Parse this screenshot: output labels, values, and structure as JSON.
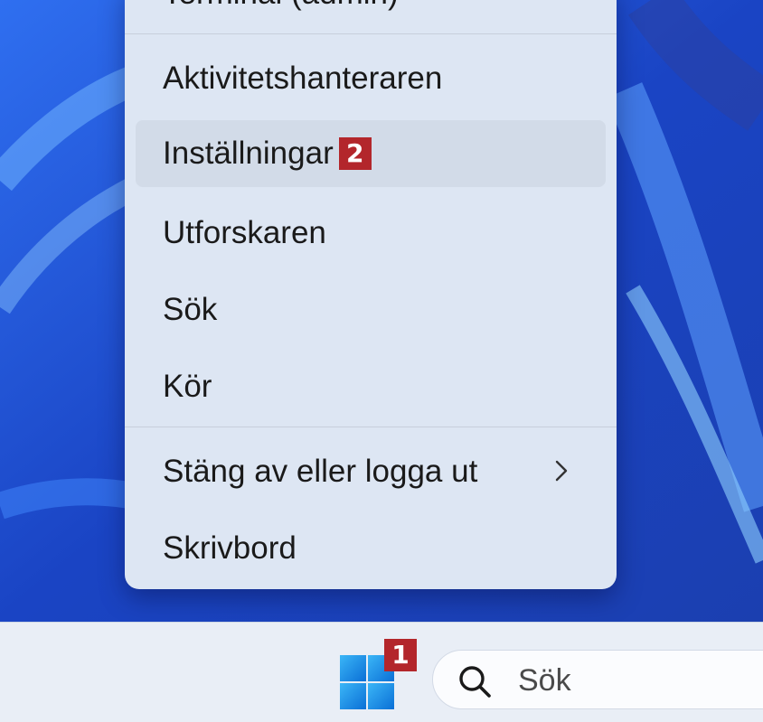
{
  "menu": {
    "items": [
      {
        "label": "Terminal (admin)"
      },
      {
        "label": "Aktivitetshanteraren"
      },
      {
        "label": "Inställningar",
        "badge": "2"
      },
      {
        "label": "Utforskaren"
      },
      {
        "label": "Sök"
      },
      {
        "label": "Kör"
      },
      {
        "label": "Stäng av eller logga ut",
        "icon": "chevron-right-icon"
      },
      {
        "label": "Skrivbord"
      }
    ]
  },
  "taskbar": {
    "start_icon": "windows-start-icon",
    "start_badge": "1",
    "search_placeholder": "Sök",
    "search_icon": "search-icon"
  },
  "colors": {
    "wallpaper_blue": "#1f4fd0",
    "menu_bg": "#dde6f3",
    "badge_red": "#b3262b",
    "taskbar_bg": "#e9eef6"
  }
}
